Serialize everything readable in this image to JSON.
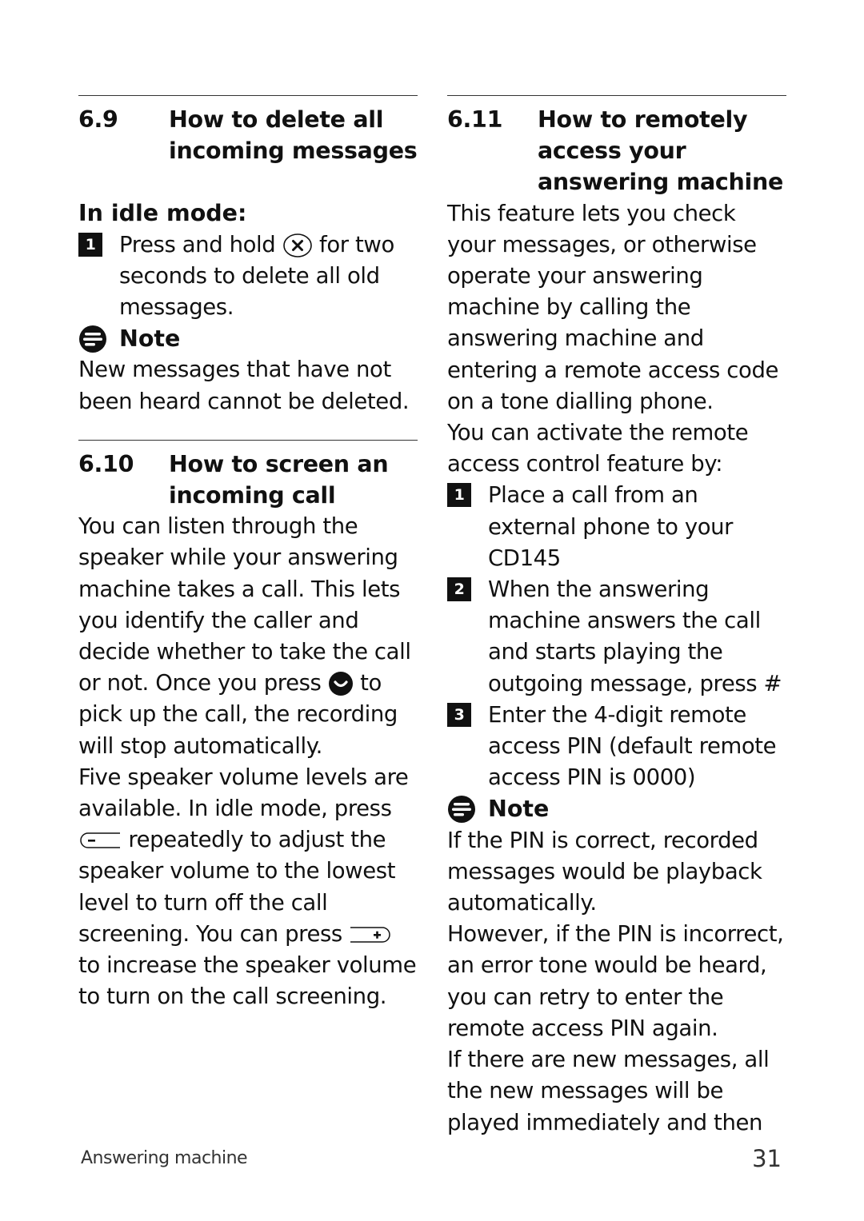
{
  "left_column": {
    "section_6_9": {
      "number": "6.9",
      "title": "How to delete all incoming messages",
      "subheading": "In idle mode:",
      "steps": [
        {
          "num": "1",
          "text_before": "Press and hold",
          "icon": "delete-x-key-icon",
          "text_after": "for two seconds to delete all old messages."
        }
      ],
      "note": {
        "label": "Note",
        "icon": "note-icon",
        "text": "New messages that have not been heard cannot be deleted."
      }
    },
    "section_6_10": {
      "number": "6.10",
      "title": "How to screen an incoming call",
      "para1_before": "You can listen through the speaker while your answering machine takes a call. This lets you identify the caller and decide whether to take the call or not. Once you press",
      "para1_icon": "talk-key-icon",
      "para1_after": "to pick up the call, the recording will stop automatically.",
      "para2_before": "Five speaker volume levels are available. In idle mode, press",
      "para2_icon1": "volume-down-key-icon",
      "para2_mid": "repeatedly to adjust the speaker volume to the lowest level to turn off the call screening. You can press",
      "para2_icon2": "volume-up-key-icon",
      "para2_after": "to increase the speaker volume to turn on the call screening."
    }
  },
  "right_column": {
    "section_6_11": {
      "number": "6.11",
      "title": "How to remotely access your answering machine",
      "intro": "This feature lets you check your messages, or otherwise operate your answering machine by calling the answering machine and entering a remote access code on a tone dialling phone.",
      "intro2": "You can activate the remote access control feature by:",
      "steps": [
        {
          "num": "1",
          "text": "Place a call from an external phone to your CD145"
        },
        {
          "num": "2",
          "text": "When the answering machine answers the call and starts playing the outgoing message, press #"
        },
        {
          "num": "3",
          "text": "Enter the 4-digit remote access PIN (default remote access PIN is 0000)"
        }
      ],
      "note": {
        "label": "Note",
        "icon": "note-icon",
        "para1": "If the PIN is correct, recorded messages would be playback automatically.",
        "para2": "However, if the PIN is incorrect, an error tone would be heard, you can retry to enter the remote access PIN again.",
        "para3": "If there are new messages, all the new messages will be played immediately and then"
      }
    }
  },
  "footer": {
    "chapter": "Answering machine",
    "page_number": "31"
  }
}
